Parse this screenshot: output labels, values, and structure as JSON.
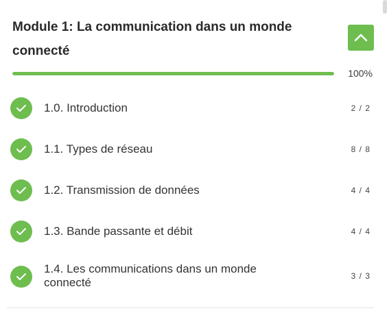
{
  "module": {
    "title": "Module 1: La communication dans un monde connecté",
    "progress_percent": 100,
    "progress_label": "100%",
    "collapse_icon": "chevron-up-icon"
  },
  "lessons": [
    {
      "label": "1.0. Introduction",
      "count": "2 / 2",
      "status": "completed"
    },
    {
      "label": "1.1. Types de réseau",
      "count": "8 / 8",
      "status": "completed"
    },
    {
      "label": "1.2. Transmission de données",
      "count": "4 / 4",
      "status": "completed"
    },
    {
      "label": "1.3. Bande passante et débit",
      "count": "4 / 4",
      "status": "completed"
    },
    {
      "label": "1.4. Les communications dans un monde connecté",
      "count": "3 / 3",
      "status": "completed"
    }
  ],
  "colors": {
    "accent": "#6ebd4f"
  }
}
